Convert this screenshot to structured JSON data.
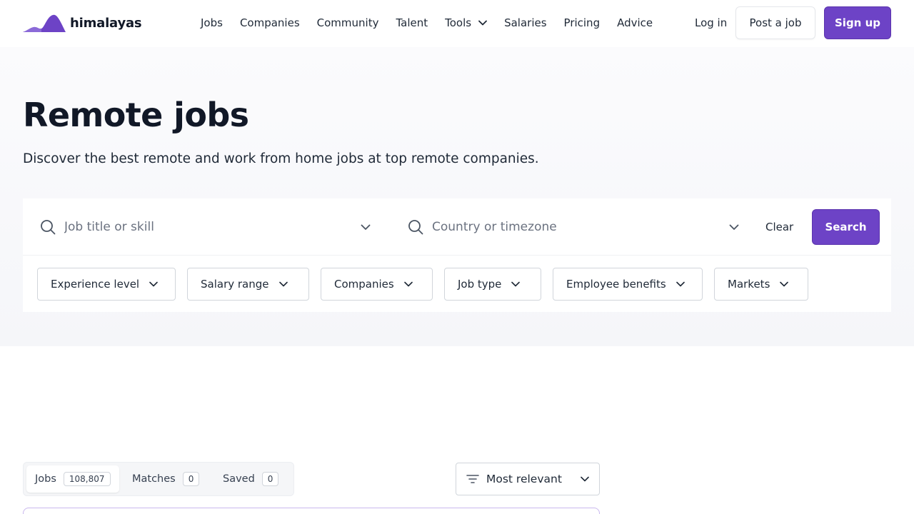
{
  "brand": {
    "name": "himalayas",
    "accent": "#6d43c6"
  },
  "nav": {
    "items": [
      {
        "label": "Jobs"
      },
      {
        "label": "Companies"
      },
      {
        "label": "Community"
      },
      {
        "label": "Talent"
      },
      {
        "label": "Tools",
        "icon": "chevron-down-icon"
      },
      {
        "label": "Salaries"
      },
      {
        "label": "Pricing"
      },
      {
        "label": "Advice"
      }
    ],
    "login": "Log in",
    "post_job": "Post a job",
    "signup": "Sign up"
  },
  "hero": {
    "title": "Remote jobs",
    "subtitle": "Discover the best remote and work from home jobs at top remote companies."
  },
  "search": {
    "job_placeholder": "Job title or skill",
    "location_placeholder": "Country or timezone",
    "clear": "Clear",
    "submit": "Search"
  },
  "filters": [
    {
      "label": "Experience level"
    },
    {
      "label": "Salary range"
    },
    {
      "label": "Companies"
    },
    {
      "label": "Job type"
    },
    {
      "label": "Employee benefits"
    },
    {
      "label": "Markets"
    }
  ],
  "tabs": [
    {
      "label": "Jobs",
      "count": "108,807",
      "active": true
    },
    {
      "label": "Matches",
      "count": "0"
    },
    {
      "label": "Saved",
      "count": "0"
    }
  ],
  "sort": {
    "label": "Most relevant"
  }
}
